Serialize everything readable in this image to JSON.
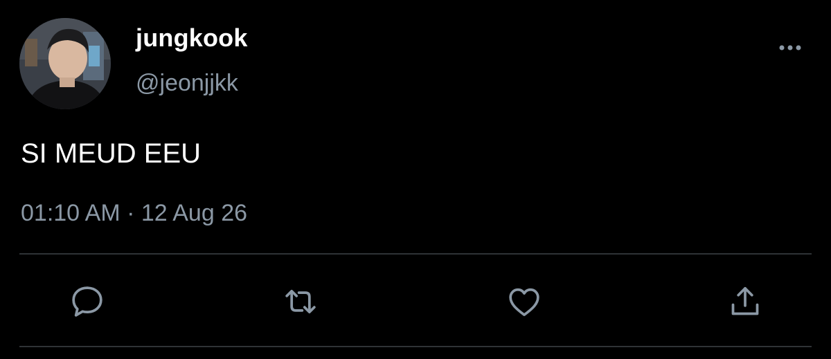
{
  "tweet": {
    "author": {
      "name": "jungkook",
      "handle": "@jeonjjkk"
    },
    "text": "SI MEUD EEU",
    "timestamp": "01:10 AM · 12 Aug 26"
  },
  "icons": {
    "more": "more-horizontal-icon",
    "reply": "reply-icon",
    "retweet": "retweet-icon",
    "like": "heart-icon",
    "share": "share-icon"
  },
  "colors": {
    "background": "#000000",
    "text": "#ffffff",
    "secondary_text": "#8b98a5",
    "divider": "#2f3336",
    "icon": "#8b98a5"
  }
}
